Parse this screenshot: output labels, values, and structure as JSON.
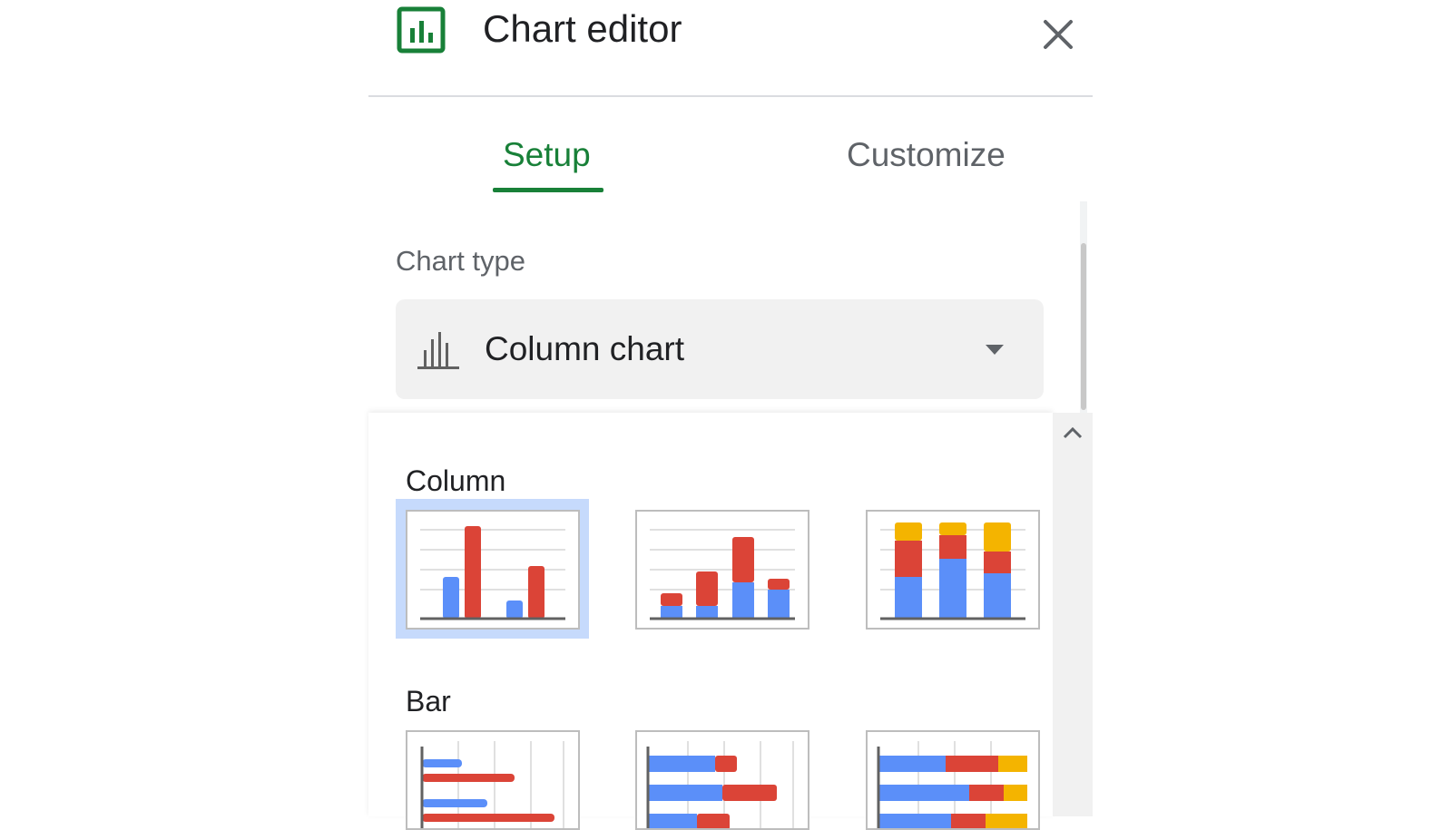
{
  "header": {
    "title": "Chart editor",
    "icon": "chart-editor-icon",
    "close_icon": "close-icon"
  },
  "tabs": [
    {
      "label": "Setup",
      "active": true
    },
    {
      "label": "Customize",
      "active": false
    }
  ],
  "chart_type": {
    "label": "Chart type",
    "selected": "Column chart",
    "icon": "column-chart-icon",
    "caret_icon": "caret-down-icon"
  },
  "dropdown": {
    "scroll_up_icon": "chevron-up-icon",
    "sections": [
      {
        "label": "Column",
        "options": [
          "column-chart",
          "stacked-column-chart",
          "100-stacked-column-chart"
        ],
        "selected_index": 0
      },
      {
        "label": "Bar",
        "options": [
          "bar-chart",
          "stacked-bar-chart",
          "100-stacked-bar-chart"
        ],
        "selected_index": null
      }
    ]
  },
  "colors": {
    "accent_green": "#188038",
    "series_blue": "#5b8ff9",
    "series_red": "#db4437",
    "series_yellow": "#f4b400",
    "selection": "#c6dafc"
  }
}
